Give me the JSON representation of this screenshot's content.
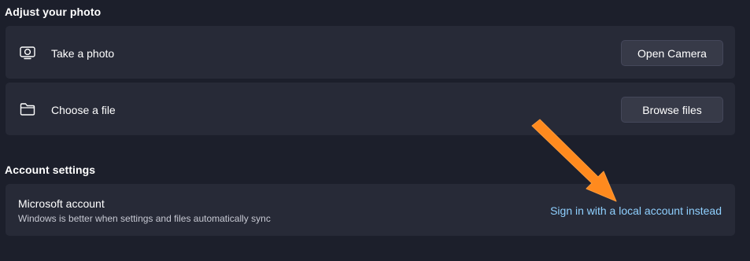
{
  "adjust_photo": {
    "title": "Adjust your photo",
    "take_photo": {
      "icon": "camera-icon",
      "label": "Take a photo",
      "button_label": "Open Camera"
    },
    "choose_file": {
      "icon": "folder-icon",
      "label": "Choose a file",
      "button_label": "Browse files"
    }
  },
  "account_settings": {
    "title": "Account settings",
    "microsoft_account": {
      "title": "Microsoft account",
      "subtitle": "Windows is better when settings and files automatically sync",
      "link_label": "Sign in with a local account instead"
    }
  },
  "annotation": {
    "icon": "orange-arrow-icon",
    "color": "#ff8a1e"
  },
  "colors": {
    "background": "#1c1f2b",
    "card": "#272a37",
    "button": "#373a48",
    "link": "#8fd0ff"
  }
}
